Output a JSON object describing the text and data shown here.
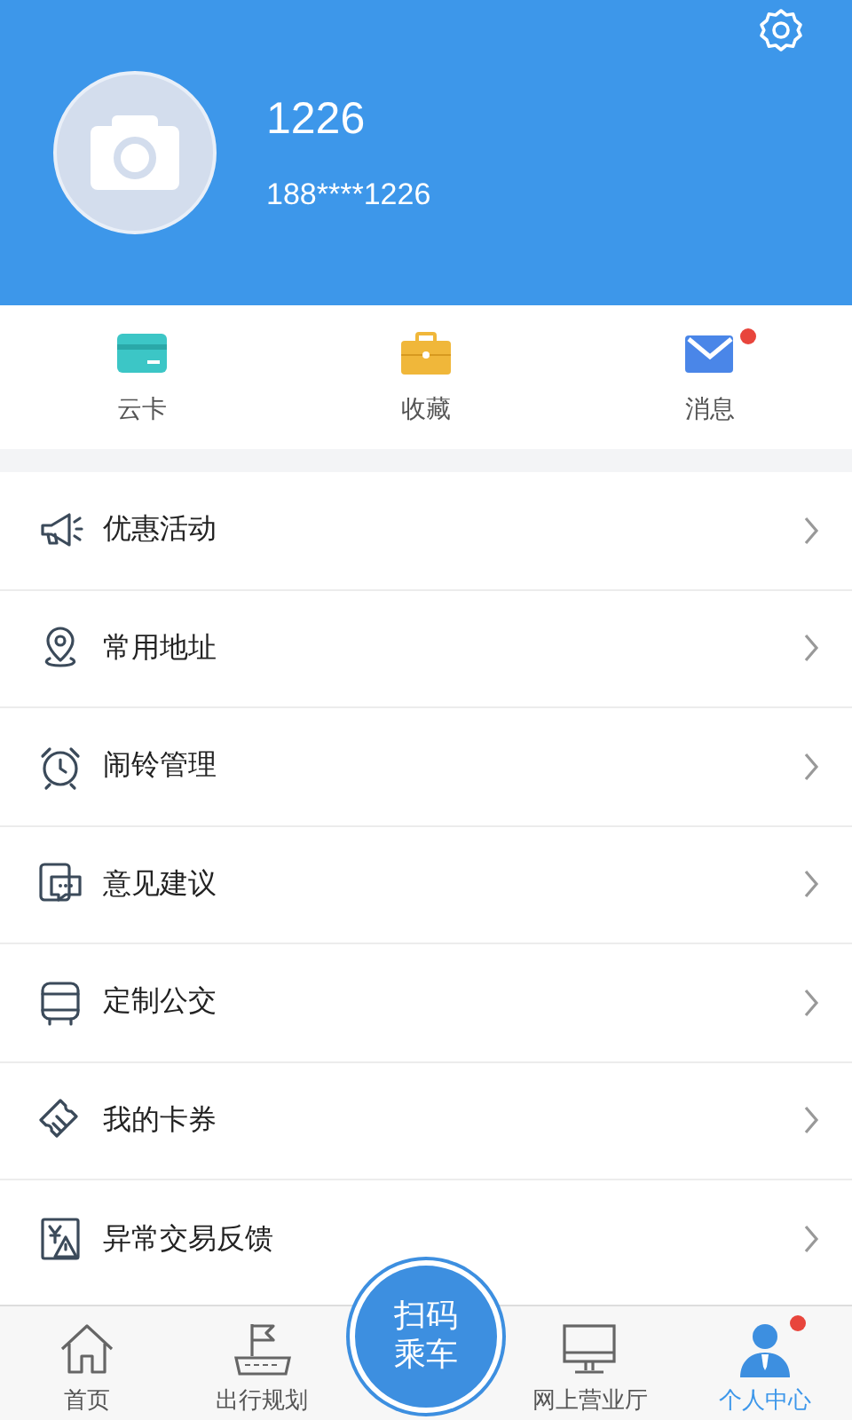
{
  "profile": {
    "name": "1226",
    "phone": "188****1226"
  },
  "shortcuts": [
    {
      "label": "云卡",
      "unread": false
    },
    {
      "label": "收藏",
      "unread": false
    },
    {
      "label": "消息",
      "unread": true
    }
  ],
  "menu": [
    {
      "label": "优惠活动"
    },
    {
      "label": "常用地址"
    },
    {
      "label": "闹铃管理"
    },
    {
      "label": "意见建议"
    },
    {
      "label": "定制公交"
    },
    {
      "label": "我的卡券"
    },
    {
      "label": "异常交易反馈"
    }
  ],
  "tabs": [
    {
      "kind": "tab",
      "label": "首页",
      "selected": false,
      "unread": false
    },
    {
      "kind": "tab",
      "label": "出行规划",
      "selected": false,
      "unread": false
    },
    {
      "kind": "scan",
      "label": "扫码乘车"
    },
    {
      "kind": "tab",
      "label": "网上营业厅",
      "selected": false,
      "unread": false
    },
    {
      "kind": "tab",
      "label": "个人中心",
      "selected": true,
      "unread": true
    }
  ]
}
